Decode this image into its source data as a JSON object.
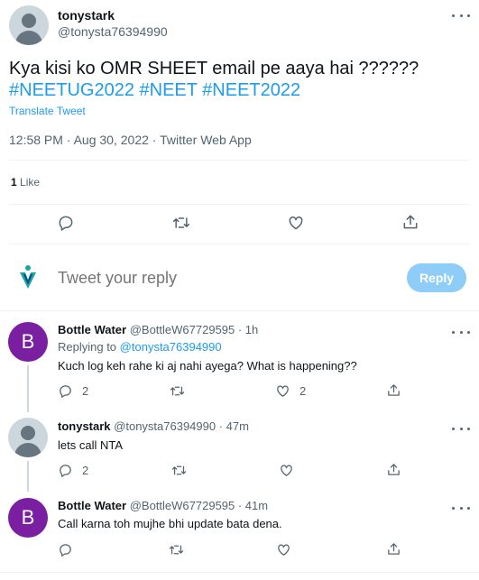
{
  "tweet": {
    "name": "tonystark",
    "handle": "@tonysta76394990",
    "text": "Kya kisi ko OMR SHEET email pe aaya hai ??????",
    "hashtags": "#NEETUG2022 #NEET #NEET2022",
    "translate": "Translate Tweet",
    "meta": "12:58 PM · Aug 30, 2022 · Twitter Web App",
    "likes_count": "1",
    "likes_label": "Like"
  },
  "composer": {
    "placeholder": "Tweet your reply",
    "reply_label": "Reply"
  },
  "replies": [
    {
      "avatar_letter": "B",
      "name": "Bottle Water",
      "handle_time": "@BottleW67729595 · 1h",
      "replying_prefix": "Replying to",
      "replying_handle": "@tonysta76394990",
      "text": "Kuch log keh rahe ki aj nahi ayega? What is happening??",
      "reply_count": "2",
      "like_count": "2"
    },
    {
      "name": "tonystark",
      "handle_time": "@tonysta76394990 · 47m",
      "text": "lets call NTA",
      "reply_count": "2"
    },
    {
      "avatar_letter": "B",
      "name": "Bottle Water",
      "handle_time": "@BottleW67729595 · 41m",
      "text": "Call karna toh mujhe bhi update bata dena."
    }
  ],
  "colors": {
    "accent": "#1d9bf0",
    "reply_button_disabled": "#8ecdf8",
    "avatar_b": "#7b1fa2"
  }
}
